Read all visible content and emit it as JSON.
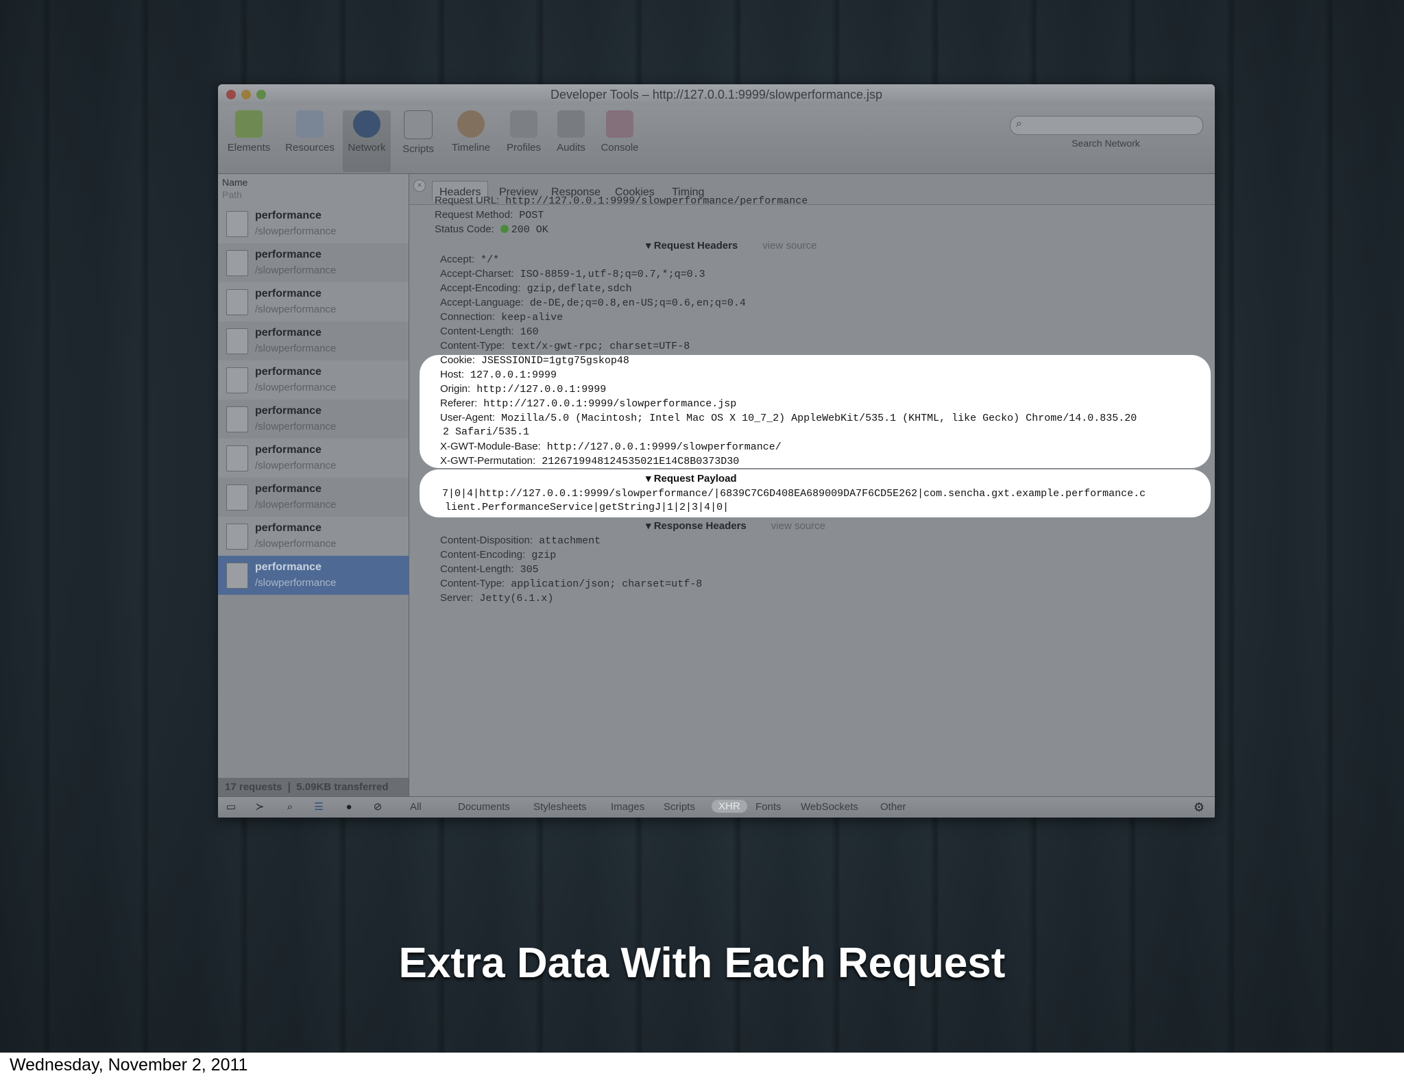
{
  "window": {
    "title": "Developer Tools – http://127.0.0.1:9999/slowperformance.jsp",
    "toolbar": [
      {
        "label": "Elements",
        "icon": "elements-icon"
      },
      {
        "label": "Resources",
        "icon": "resources-icon"
      },
      {
        "label": "Network",
        "icon": "network-icon"
      },
      {
        "label": "Scripts",
        "icon": "scripts-icon"
      },
      {
        "label": "Timeline",
        "icon": "timeline-icon"
      },
      {
        "label": "Profiles",
        "icon": "profiles-icon"
      },
      {
        "label": "Audits",
        "icon": "audits-icon"
      },
      {
        "label": "Console",
        "icon": "console-icon"
      }
    ],
    "search_label": "Search Network"
  },
  "sidebar": {
    "col_name": "Name",
    "col_path": "Path",
    "requests": [
      {
        "name": "performance",
        "path": "/slowperformance"
      },
      {
        "name": "performance",
        "path": "/slowperformance"
      },
      {
        "name": "performance",
        "path": "/slowperformance"
      },
      {
        "name": "performance",
        "path": "/slowperformance"
      },
      {
        "name": "performance",
        "path": "/slowperformance"
      },
      {
        "name": "performance",
        "path": "/slowperformance"
      },
      {
        "name": "performance",
        "path": "/slowperformance"
      },
      {
        "name": "performance",
        "path": "/slowperformance"
      },
      {
        "name": "performance",
        "path": "/slowperformance"
      },
      {
        "name": "performance",
        "path": "/slowperformance"
      }
    ],
    "footer": "17 requests  ❘  5.09KB transferred"
  },
  "tabs": [
    "Headers",
    "Preview",
    "Response",
    "Cookies",
    "Timing"
  ],
  "general": {
    "url_key": "Request URL:",
    "url_val": "http://127.0.0.1:9999/slowperformance/performance",
    "method_key": "Request Method:",
    "method_val": "POST",
    "status_key": "Status Code:",
    "status_val": "200 OK"
  },
  "request_headers_title": "Request Headers",
  "view_source": "view source",
  "request_headers": [
    {
      "k": "Accept:",
      "v": "*/*"
    },
    {
      "k": "Accept-Charset:",
      "v": "ISO-8859-1,utf-8;q=0.7,*;q=0.3"
    },
    {
      "k": "Accept-Encoding:",
      "v": "gzip,deflate,sdch"
    },
    {
      "k": "Accept-Language:",
      "v": "de-DE,de;q=0.8,en-US;q=0.6,en;q=0.4"
    },
    {
      "k": "Connection:",
      "v": "keep-alive"
    },
    {
      "k": "Content-Length:",
      "v": "160"
    },
    {
      "k": "Content-Type:",
      "v": "text/x-gwt-rpc; charset=UTF-8"
    },
    {
      "k": "Cookie:",
      "v": "JSESSIONID=1gtg75gskop48"
    },
    {
      "k": "Host:",
      "v": "127.0.0.1:9999"
    },
    {
      "k": "Origin:",
      "v": "http://127.0.0.1:9999"
    },
    {
      "k": "Referer:",
      "v": "http://127.0.0.1:9999/slowperformance.jsp"
    },
    {
      "k": "User-Agent:",
      "v": "Mozilla/5.0 (Macintosh; Intel Mac OS X 10_7_2) AppleWebKit/535.1 (KHTML, like Gecko) Chrome/14.0.835.20"
    },
    {
      "k": "",
      "v": "2 Safari/535.1"
    },
    {
      "k": "X-GWT-Module-Base:",
      "v": "http://127.0.0.1:9999/slowperformance/"
    },
    {
      "k": "X-GWT-Permutation:",
      "v": "2126719948124535021E14C8B0373D30"
    }
  ],
  "payload_title": "Request Payload",
  "payload_lines": [
    "7|0|4|http://127.0.0.1:9999/slowperformance/|6839C7C6D408EA689009DA7F6CD5E262|com.sencha.gxt.example.performance.c",
    "lient.PerformanceService|getStringJ|1|2|3|4|0|"
  ],
  "response_headers_title": "Response Headers",
  "response_headers": [
    {
      "k": "Content-Disposition:",
      "v": "attachment"
    },
    {
      "k": "Content-Encoding:",
      "v": "gzip"
    },
    {
      "k": "Content-Length:",
      "v": "305"
    },
    {
      "k": "Content-Type:",
      "v": "application/json; charset=utf-8"
    },
    {
      "k": "Server:",
      "v": "Jetty(6.1.x)"
    }
  ],
  "filters": [
    "All",
    "Documents",
    "Stylesheets",
    "Images",
    "Scripts",
    "XHR",
    "Fonts",
    "WebSockets",
    "Other"
  ],
  "caption": "Extra Data With Each Request",
  "date": "Wednesday, November 2, 2011"
}
